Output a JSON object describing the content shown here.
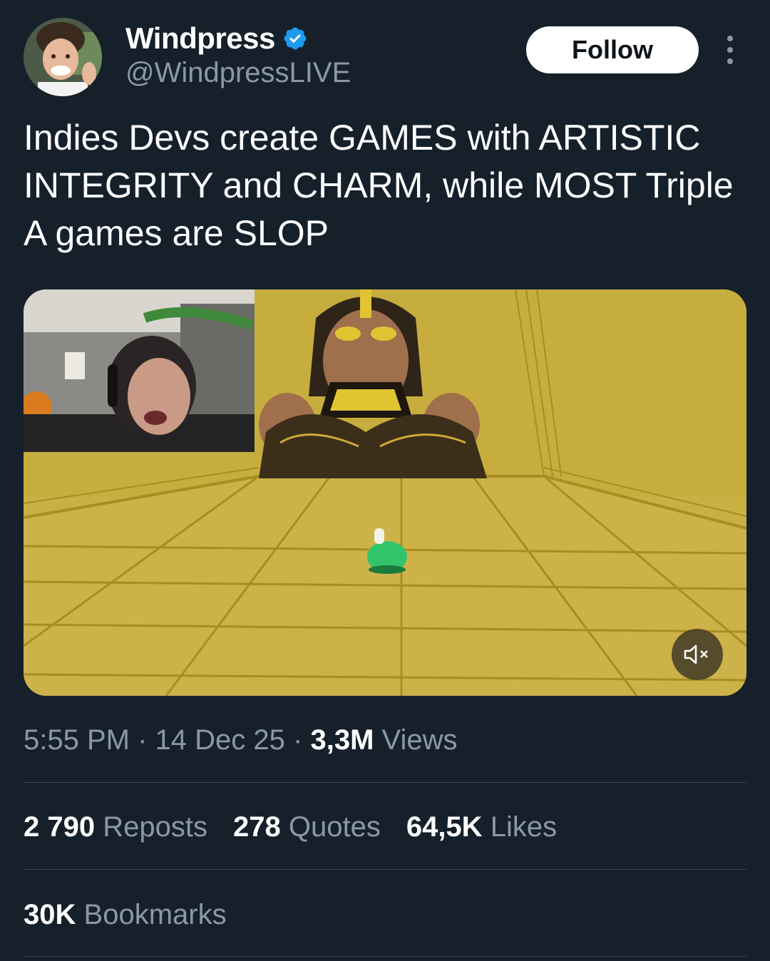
{
  "author": {
    "display_name": "Windpress",
    "handle": "@WindpressLIVE",
    "verified": true,
    "avatar_icon": "avatar-photo",
    "verified_icon": "verified-badge-icon",
    "verified_color": "#1d9bf0"
  },
  "actions": {
    "follow_label": "Follow",
    "more_icon": "more-vertical-icon"
  },
  "tweet": {
    "text": "Indies Devs create GAMES with ARTISTIC INTEGRITY and CHARM, while MOST Triple A games are SLOP"
  },
  "media": {
    "type": "video",
    "muted": true,
    "mute_icon": "volume-muted-icon"
  },
  "meta": {
    "time": "5:55 PM",
    "separator": "·",
    "date": "14 Dec 25",
    "views_count": "3,3M",
    "views_label": "Views"
  },
  "stats": {
    "reposts_count": "2 790",
    "reposts_label": "Reposts",
    "quotes_count": "278",
    "quotes_label": "Quotes",
    "likes_count": "64,5K",
    "likes_label": "Likes",
    "bookmarks_count": "30K",
    "bookmarks_label": "Bookmarks"
  },
  "colors": {
    "background": "#15202b",
    "text_primary": "#ffffff",
    "text_secondary": "#8b98a5",
    "divider": "#38444d",
    "follow_button_bg": "#ffffff",
    "follow_button_text": "#0f1419"
  }
}
